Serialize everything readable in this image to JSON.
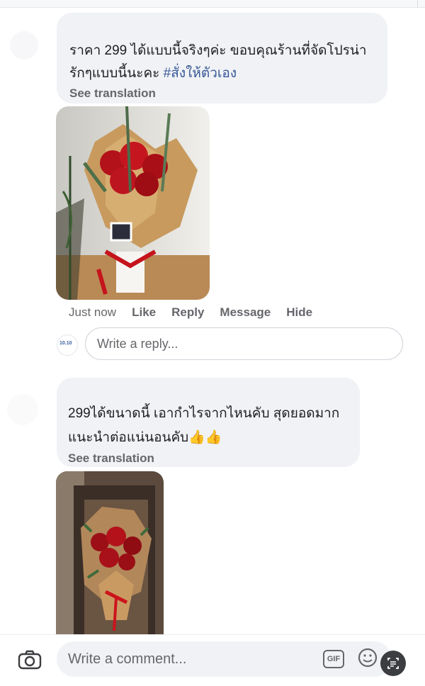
{
  "comment1": {
    "text_line1": "ราคา 299 ได้แบบนี้จริงๆค่ะ  ขอบคุณร้านที่จัดโปรน่า",
    "text_line2": "รักๆแบบนี้นะคะ ",
    "hashtag": "#สั่งให้ตัวเอง",
    "see_translation": "See translation"
  },
  "actions": {
    "time": "Just now",
    "like": "Like",
    "reply": "Reply",
    "message": "Message",
    "hide": "Hide"
  },
  "reply_box": {
    "avatar_text": "10.10",
    "placeholder": "Write a reply..."
  },
  "comment2": {
    "text_line1": "299ได้ขนาดนี้ เอากำไรจากไหนคับ สุดยอดมาก",
    "text_line2": "แนะนำต่อแน่นอนคับ👍👍",
    "see_translation": "See translation"
  },
  "composer": {
    "placeholder": "Write a comment...",
    "gif_label": "GIF",
    "icons": [
      "camera-icon",
      "gif-icon",
      "emoji-icon",
      "scan-text-icon"
    ]
  },
  "colors": {
    "bubble_bg": "#f0f2f5",
    "hashtag": "#385898",
    "muted": "#65676b"
  }
}
